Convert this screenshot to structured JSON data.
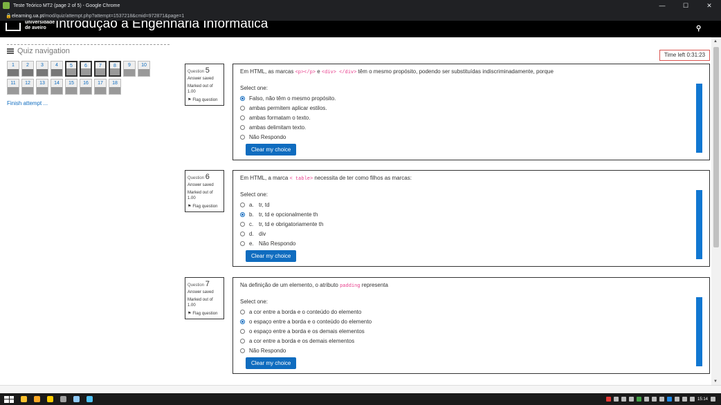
{
  "window": {
    "title": "Teste Teórico MT2 (page 2 of 5) - Google Chrome",
    "url_host": "elearning.ua.pt",
    "url_path": "/mod/quiz/attempt.php?attempt=1537218&cmid=972871&page=1"
  },
  "header": {
    "university": "universidade\nde aveiro",
    "course_title": "Introdução à Engenharia Informática"
  },
  "quiz_nav": {
    "title": "Quiz navigation",
    "buttons": [
      {
        "label": "1",
        "state": "answered"
      },
      {
        "label": "2",
        "state": "answered"
      },
      {
        "label": "3",
        "state": "answered"
      },
      {
        "label": "4",
        "state": "answered"
      },
      {
        "label": "5",
        "state": "current"
      },
      {
        "label": "6",
        "state": "current"
      },
      {
        "label": "7",
        "state": "current"
      },
      {
        "label": "8",
        "state": "current"
      },
      {
        "label": "9",
        "state": "notyet"
      },
      {
        "label": "10",
        "state": "notyet"
      },
      {
        "label": "11",
        "state": "notyet"
      },
      {
        "label": "12",
        "state": "notyet"
      },
      {
        "label": "13",
        "state": "notyet"
      },
      {
        "label": "14",
        "state": "notyet"
      },
      {
        "label": "15",
        "state": "notyet"
      },
      {
        "label": "16",
        "state": "notyet"
      },
      {
        "label": "17",
        "state": "notyet"
      },
      {
        "label": "18",
        "state": "notyet"
      }
    ],
    "finish_label": "Finish attempt ..."
  },
  "timer": "Time left 0:31:23",
  "questions": [
    {
      "prefix": "Question",
      "number": "5",
      "state": "Answer saved",
      "grade": "Marked out of 1.00",
      "flag": "Flag question",
      "text_parts": [
        "Em HTML, as marcas ",
        "<p></p>",
        " e ",
        "<div> </div>",
        " têm o mesmo propósito, podendo ser substituídas indiscriminadamente, porque"
      ],
      "select_one": "Select one:",
      "options": [
        {
          "letter": "",
          "text": "Falso, não têm o mesmo propósito.",
          "checked": true
        },
        {
          "letter": "",
          "text": "ambas permitem aplicar estilos.",
          "checked": false
        },
        {
          "letter": "",
          "text": "ambas formatam o texto.",
          "checked": false
        },
        {
          "letter": "",
          "text": "ambas delimitam texto.",
          "checked": false
        },
        {
          "letter": "",
          "text": "Não Respondo",
          "checked": false
        }
      ],
      "clear_label": "Clear my choice"
    },
    {
      "prefix": "Question",
      "number": "6",
      "state": "Answer saved",
      "grade": "Marked out of 1.00",
      "flag": "Flag question",
      "text_parts": [
        "Em HTML, a marca ",
        "< table>",
        " necessita de ter como filhos as marcas:",
        "",
        ""
      ],
      "select_one": "Select one:",
      "options": [
        {
          "letter": "a.",
          "text": "tr, td",
          "checked": false
        },
        {
          "letter": "b.",
          "text": "tr, td e opcionalmente th",
          "checked": true
        },
        {
          "letter": "c.",
          "text": "tr, td e obrigatoriamente th",
          "checked": false
        },
        {
          "letter": "d.",
          "text": "div",
          "checked": false
        },
        {
          "letter": "e.",
          "text": "Não Respondo",
          "checked": false
        }
      ],
      "clear_label": "Clear my choice"
    },
    {
      "prefix": "Question",
      "number": "7",
      "state": "Answer saved",
      "grade": "Marked out of 1.00",
      "flag": "Flag question",
      "text_parts": [
        "Na definição de um elemento, o atributo ",
        "padding",
        " representa",
        "",
        ""
      ],
      "select_one": "Select one:",
      "options": [
        {
          "letter": "",
          "text": "a cor entre a borda e o conteúdo do elemento",
          "checked": false
        },
        {
          "letter": "",
          "text": "o espaço entre a borda e o conteúdo do elemento",
          "checked": true
        },
        {
          "letter": "",
          "text": "o espaço entre a borda e os demais elementos",
          "checked": false
        },
        {
          "letter": "",
          "text": "a cor entre a borda e os demais elementos",
          "checked": false
        },
        {
          "letter": "",
          "text": "Não Respondo",
          "checked": false
        }
      ],
      "clear_label": "Clear my choice"
    }
  ],
  "taskbar": {
    "clock": "15:14"
  },
  "colors": {
    "accent": "#0f6cbf",
    "code": "#e83e8c",
    "timer_border": "#d9534f"
  }
}
